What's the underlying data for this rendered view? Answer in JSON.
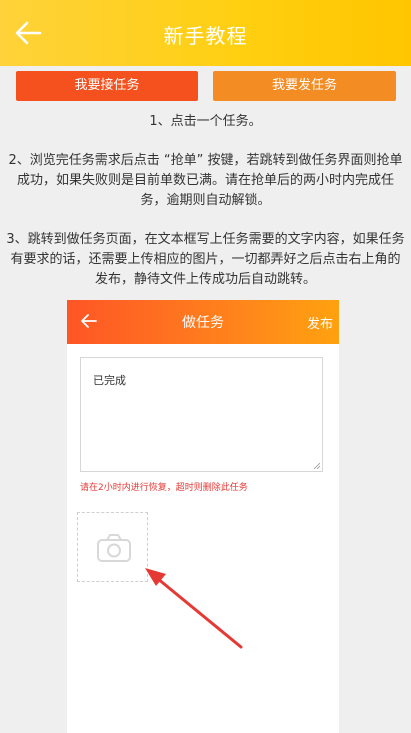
{
  "header": {
    "title": "新手教程",
    "back_icon": "arrow-left-icon"
  },
  "tabs": [
    {
      "label": "我要接任务",
      "color": "#f4511e"
    },
    {
      "label": "我要发任务",
      "color": "#f28c23"
    }
  ],
  "steps": {
    "step1": "1、点击一个任务。",
    "step2": "2、浏览完任务需求后点击 “抢单” 按键，若跳转到做任务界面则抢单成功，如果失败则是目前单数已满。请在抢单后的两小时内完成任务，逾期则自动解锁。",
    "step3": "3、跳转到做任务页面，在文本框写上任务需要的文字内容，如果任务有要求的话，还需要上传相应的图片，一切都弄好之后点击右上角的发布，静待文件上传成功后自动跳转。"
  },
  "demo": {
    "title": "做任务",
    "publish": "发布",
    "textarea_value": "已完成",
    "note": "请在2小时内进行恢复，超时则删除此任务",
    "upload_icon": "camera-icon"
  },
  "colors": {
    "header_yellow": "#ffcf10",
    "demo_orange": "#ff5526",
    "note_red": "#e53935",
    "arrow_red": "#e53935"
  }
}
